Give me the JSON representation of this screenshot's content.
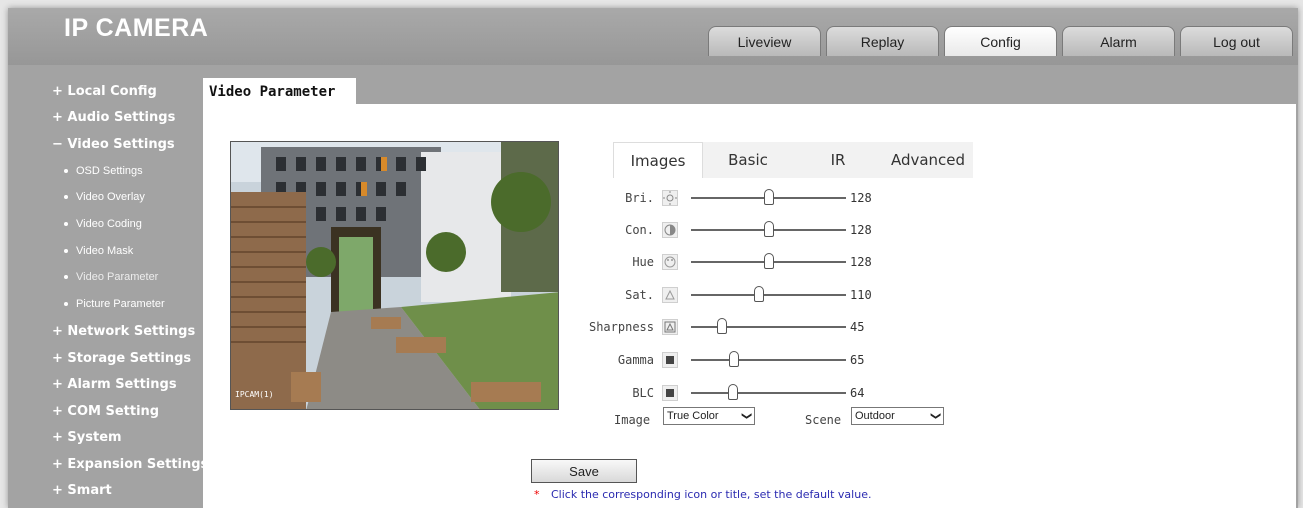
{
  "app": {
    "title": "IP CAMERA"
  },
  "nav": {
    "tabs": [
      {
        "label": "Liveview"
      },
      {
        "label": "Replay"
      },
      {
        "label": "Config"
      },
      {
        "label": "Alarm"
      },
      {
        "label": "Log out"
      }
    ],
    "active": "Config"
  },
  "sidebar": {
    "items": [
      {
        "label": "+ Local Config"
      },
      {
        "label": "+ Audio Settings"
      },
      {
        "label": "− Video Settings"
      },
      {
        "label": "OSD Settings"
      },
      {
        "label": "Video Overlay"
      },
      {
        "label": "Video Coding"
      },
      {
        "label": "Video Mask"
      },
      {
        "label": "Video Parameter"
      },
      {
        "label": "Picture Parameter"
      },
      {
        "label": "+ Network Settings"
      },
      {
        "label": "+ Storage Settings"
      },
      {
        "label": "+ Alarm Settings"
      },
      {
        "label": "+ COM Setting"
      },
      {
        "label": "+ System"
      },
      {
        "label": "+ Expansion Settings"
      },
      {
        "label": "+ Smart"
      }
    ]
  },
  "page": {
    "tab_label": "Video Parameter"
  },
  "preview": {
    "osd_text": "IPCAM(1)"
  },
  "image_tabs": [
    {
      "label": "Images"
    },
    {
      "label": "Basic"
    },
    {
      "label": "IR"
    },
    {
      "label": "Advanced"
    }
  ],
  "params": [
    {
      "label": "Bri.",
      "value": "128",
      "level": 0.5,
      "icon": "brightness-icon"
    },
    {
      "label": "Con.",
      "value": "128",
      "level": 0.5,
      "icon": "contrast-icon"
    },
    {
      "label": "Hue",
      "value": "128",
      "level": 0.5,
      "icon": "hue-icon"
    },
    {
      "label": "Sat.",
      "value": "110",
      "level": 0.43,
      "icon": "saturation-icon"
    },
    {
      "label": "Sharpness",
      "value": "45",
      "level": 0.18,
      "icon": "sharpness-icon"
    },
    {
      "label": "Gamma",
      "value": "65",
      "level": 0.25,
      "icon": "gamma-icon"
    },
    {
      "label": "BLC",
      "value": "64",
      "level": 0.25,
      "icon": "blc-icon"
    }
  ],
  "selects": {
    "image": {
      "label": "Image",
      "value": "True Color"
    },
    "scene": {
      "label": "Scene",
      "value": "Outdoor"
    }
  },
  "save_label": "Save",
  "note": {
    "marker": "*",
    "text": "Click the corresponding icon or title, set the default value."
  }
}
